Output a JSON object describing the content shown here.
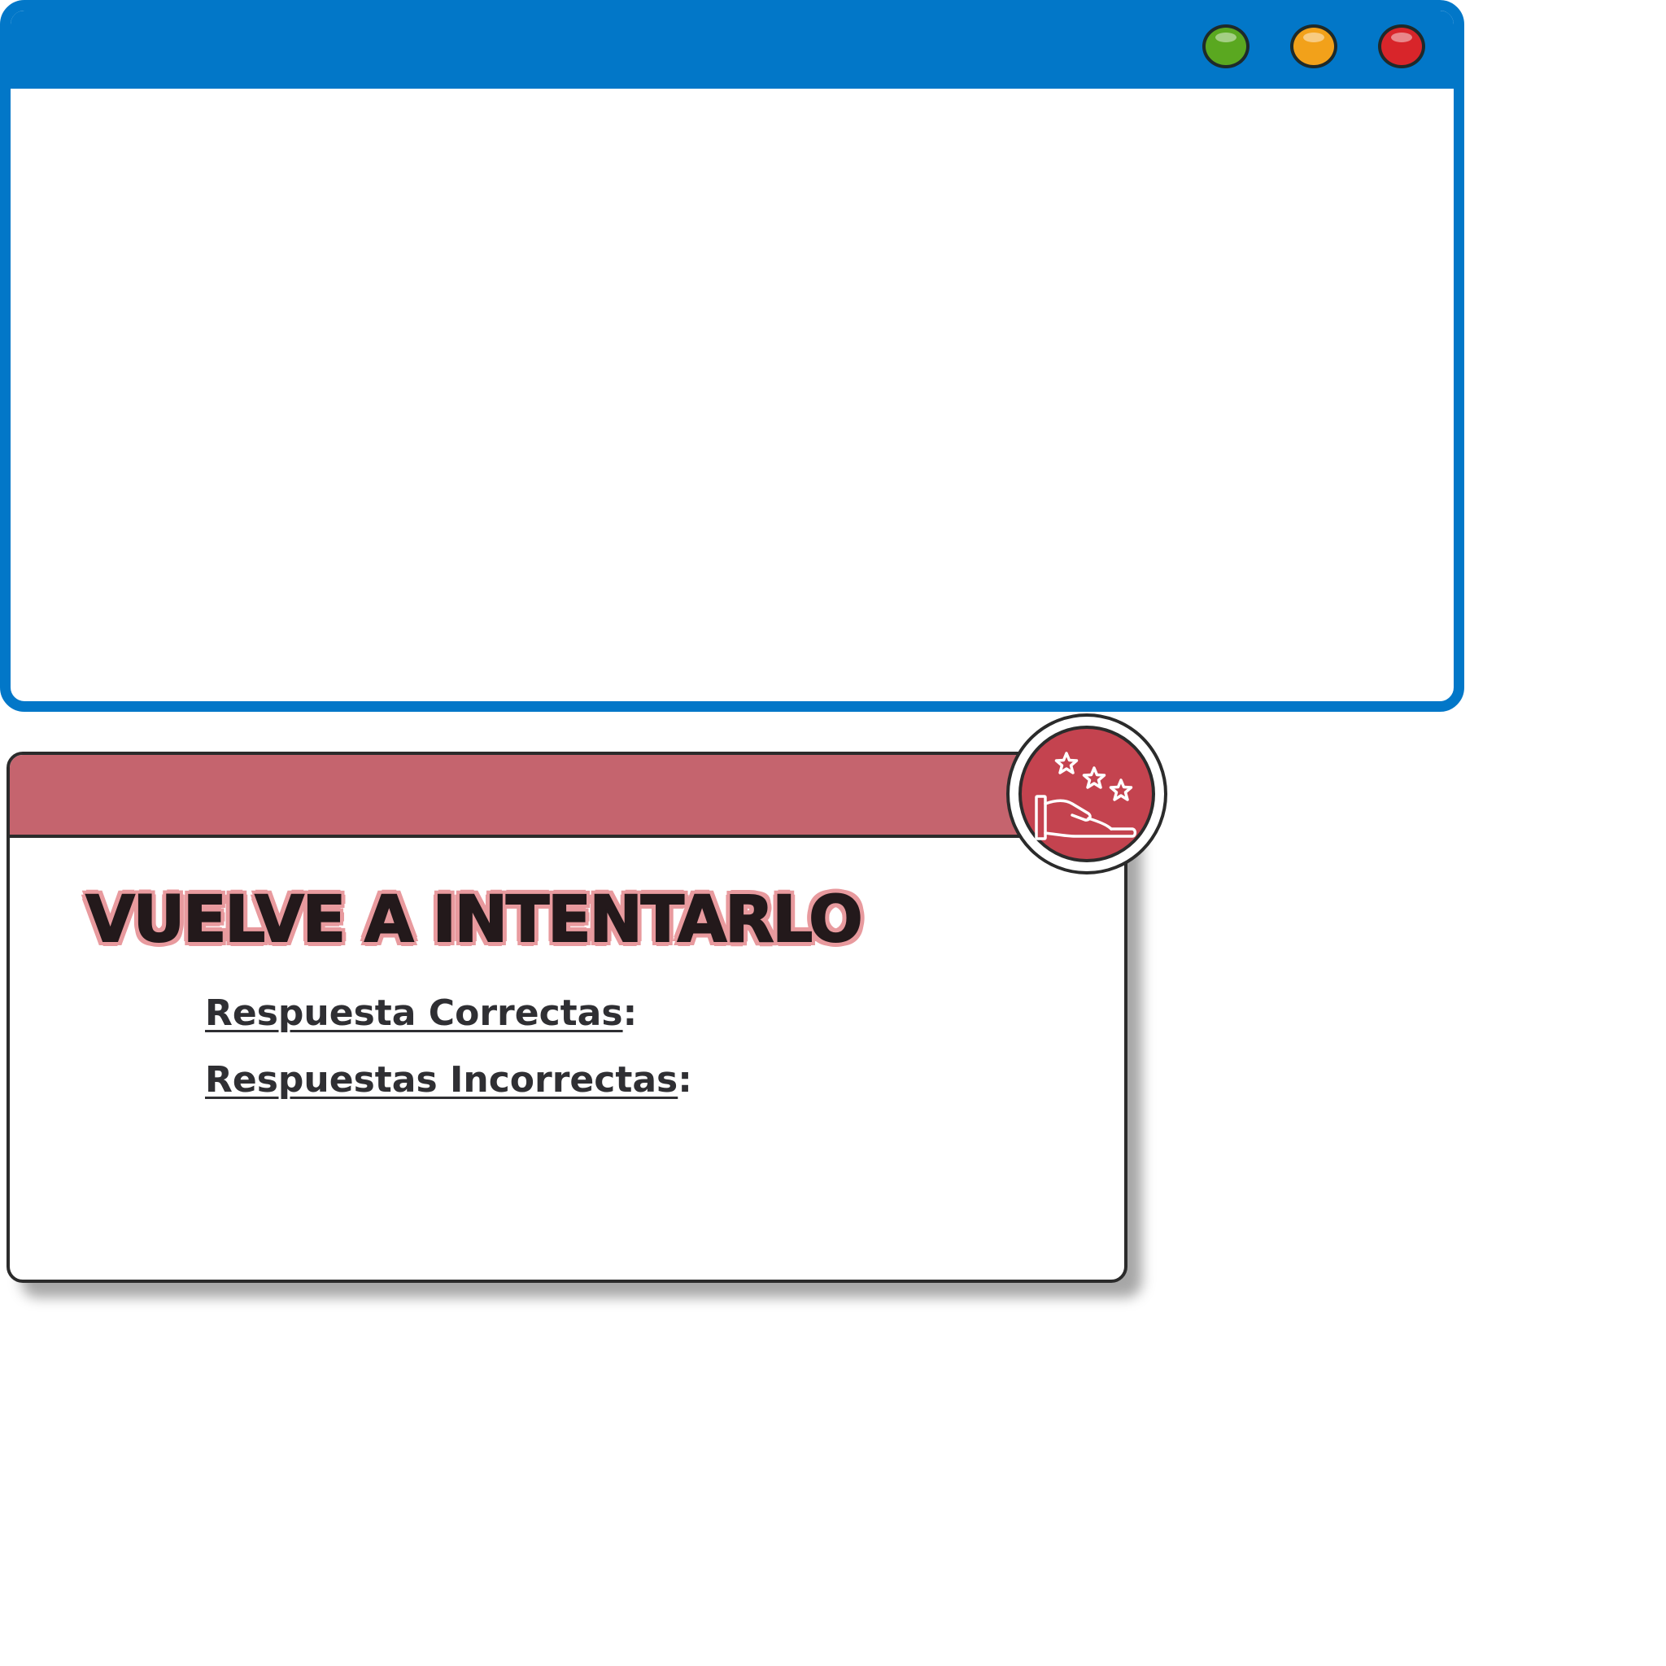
{
  "window": {
    "controls": [
      {
        "name": "green-window-button",
        "color": "#5aa820"
      },
      {
        "name": "orange-window-button",
        "color": "#f2a11a"
      },
      {
        "name": "red-window-button",
        "color": "#d8252a"
      }
    ],
    "frame_color": "#0277c8"
  },
  "result": {
    "title": "VUELVE A INTENTARLO",
    "correct_label": "Respuesta Correctas",
    "incorrect_label": "Respuestas Incorrectas",
    "colon": ":",
    "header_color": "#c5646e",
    "badge_icon": "hand-with-stars-icon"
  }
}
